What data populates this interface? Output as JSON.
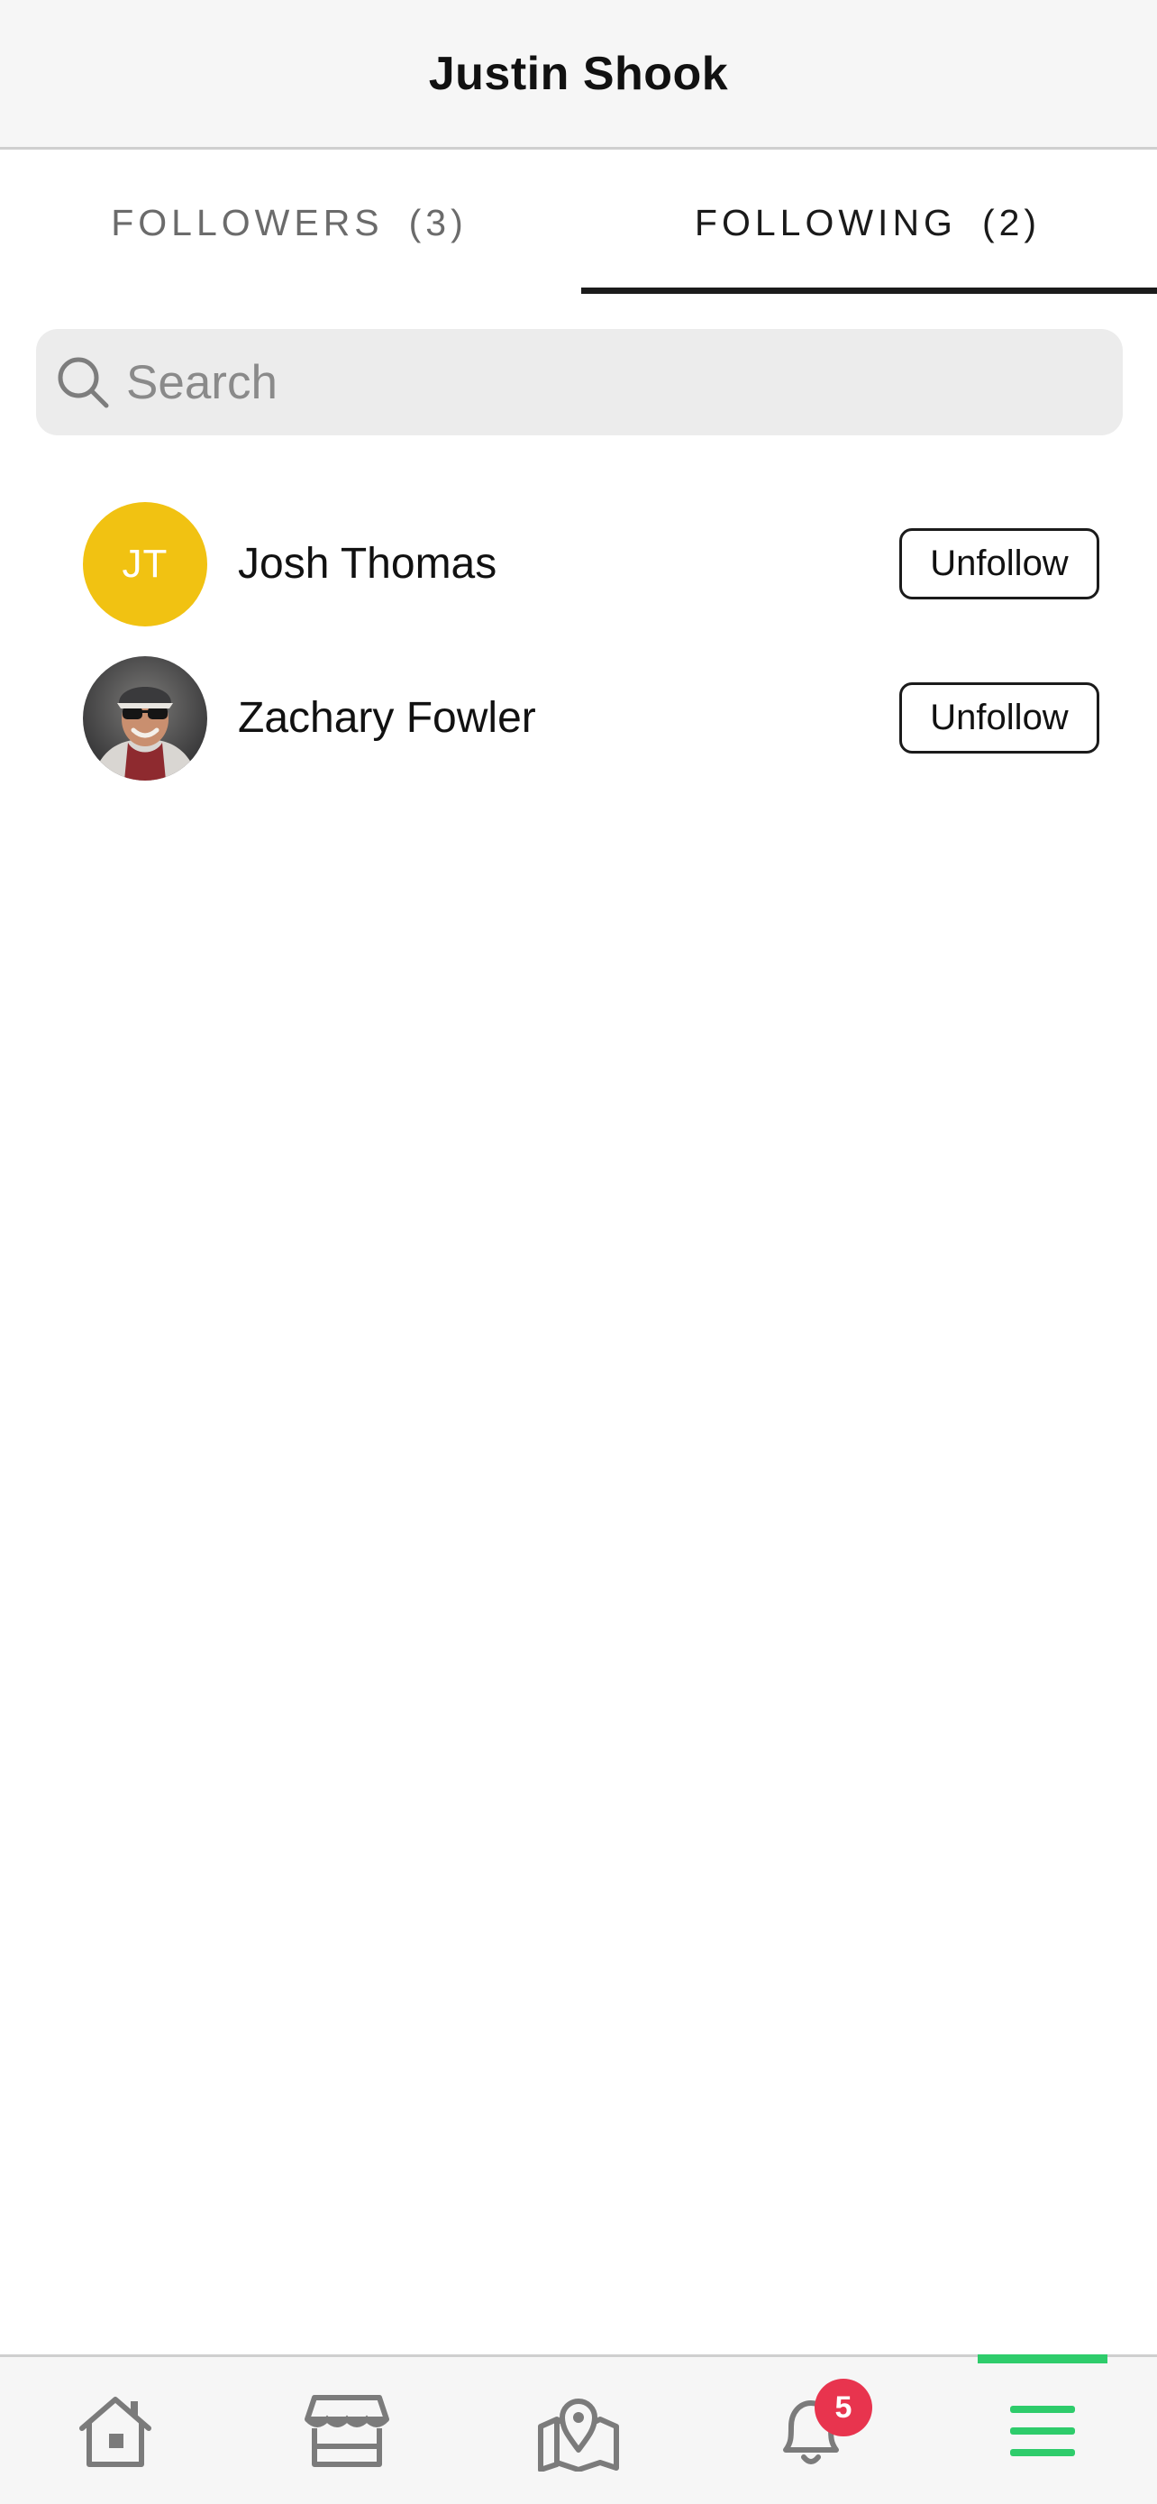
{
  "header": {
    "title": "Justin Shook"
  },
  "tabs": [
    {
      "label": "FOLLOWERS",
      "count": "(3)",
      "active": false
    },
    {
      "label": "FOLLOWING",
      "count": "(2)",
      "active": true
    }
  ],
  "search": {
    "placeholder": "Search",
    "value": ""
  },
  "following": [
    {
      "name": "Josh Thomas",
      "initials": "JT",
      "avatar_color": "#f1c212",
      "action": "Unfollow"
    },
    {
      "name": "Zachary Fowler",
      "initials": "",
      "avatar": "photo",
      "action": "Unfollow"
    }
  ],
  "bottom_nav": {
    "items": [
      {
        "icon": "home-icon"
      },
      {
        "icon": "store-icon"
      },
      {
        "icon": "map-icon"
      },
      {
        "icon": "bell-icon",
        "badge": "5"
      },
      {
        "icon": "menu-icon",
        "active": true
      }
    ],
    "accent_color": "#2ecc6b",
    "badge_color": "#e8344e"
  }
}
